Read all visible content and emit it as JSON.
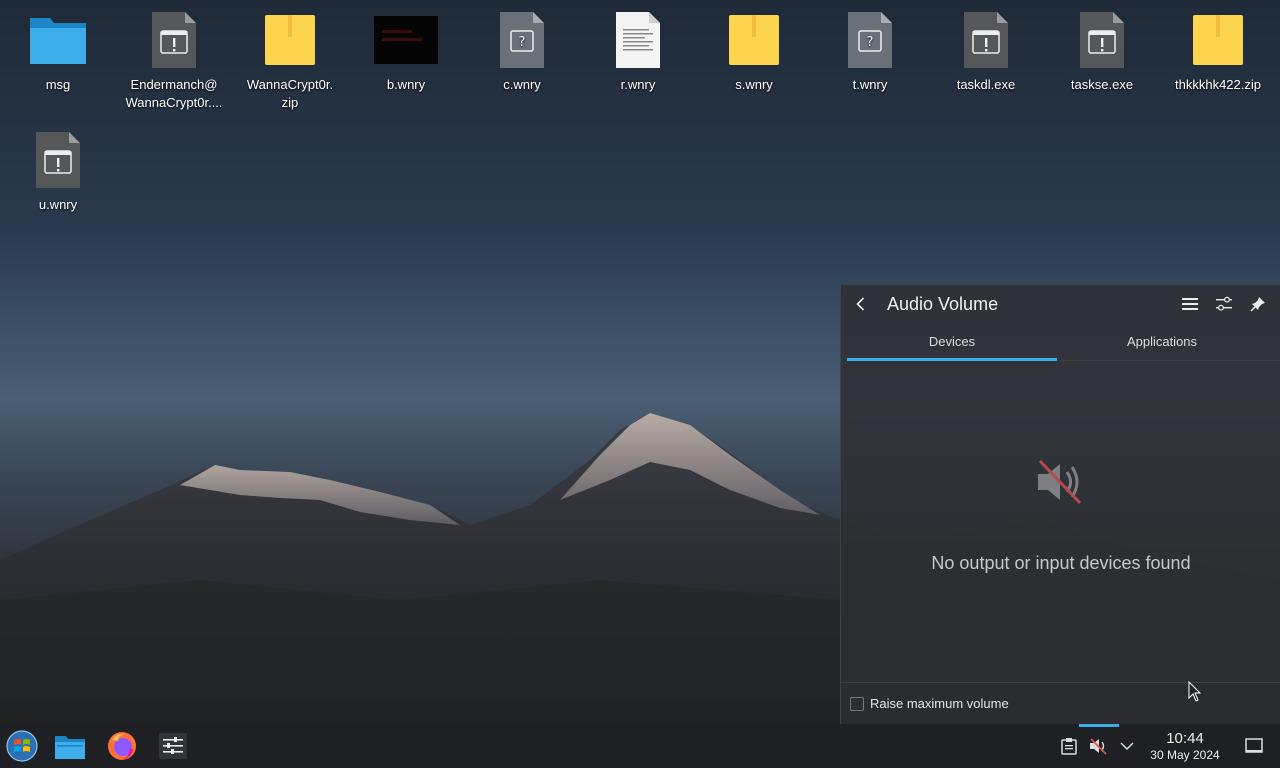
{
  "desktop": {
    "icons": [
      {
        "label": "msg",
        "type": "folder"
      },
      {
        "label": "Endermanch@\nWannaCrypt0r....",
        "type": "exe"
      },
      {
        "label": "WannaCrypt0r.\nzip",
        "type": "zip"
      },
      {
        "label": "b.wnry",
        "type": "black"
      },
      {
        "label": "c.wnry",
        "type": "unknown"
      },
      {
        "label": "r.wnry",
        "type": "text"
      },
      {
        "label": "s.wnry",
        "type": "zip"
      },
      {
        "label": "t.wnry",
        "type": "unknown"
      },
      {
        "label": "taskdl.exe",
        "type": "exe"
      },
      {
        "label": "taskse.exe",
        "type": "exe"
      },
      {
        "label": "thkkkhk422.zip",
        "type": "zip"
      },
      {
        "label": "u.wnry",
        "type": "exe"
      }
    ]
  },
  "popup": {
    "title": "Audio Volume",
    "tabs": [
      {
        "label": "Devices",
        "active": true
      },
      {
        "label": "Applications",
        "active": false
      }
    ],
    "empty_message": "No output or input devices found",
    "raise_max_label": "Raise maximum volume",
    "raise_max_checked": false,
    "icons": {
      "back": "chevron-left-icon",
      "menu": "hamburger-menu-icon",
      "configure": "sliders-icon",
      "pin": "pin-icon",
      "muted": "speaker-muted-icon"
    }
  },
  "taskbar": {
    "launchers": [
      "start-menu",
      "file-manager",
      "firefox",
      "system-settings"
    ],
    "clock": {
      "time": "10:44",
      "date": "30 May 2024"
    }
  },
  "colors": {
    "accent": "#3daee9",
    "taskbar": "#1f2023",
    "popup": "#2d2f32"
  }
}
